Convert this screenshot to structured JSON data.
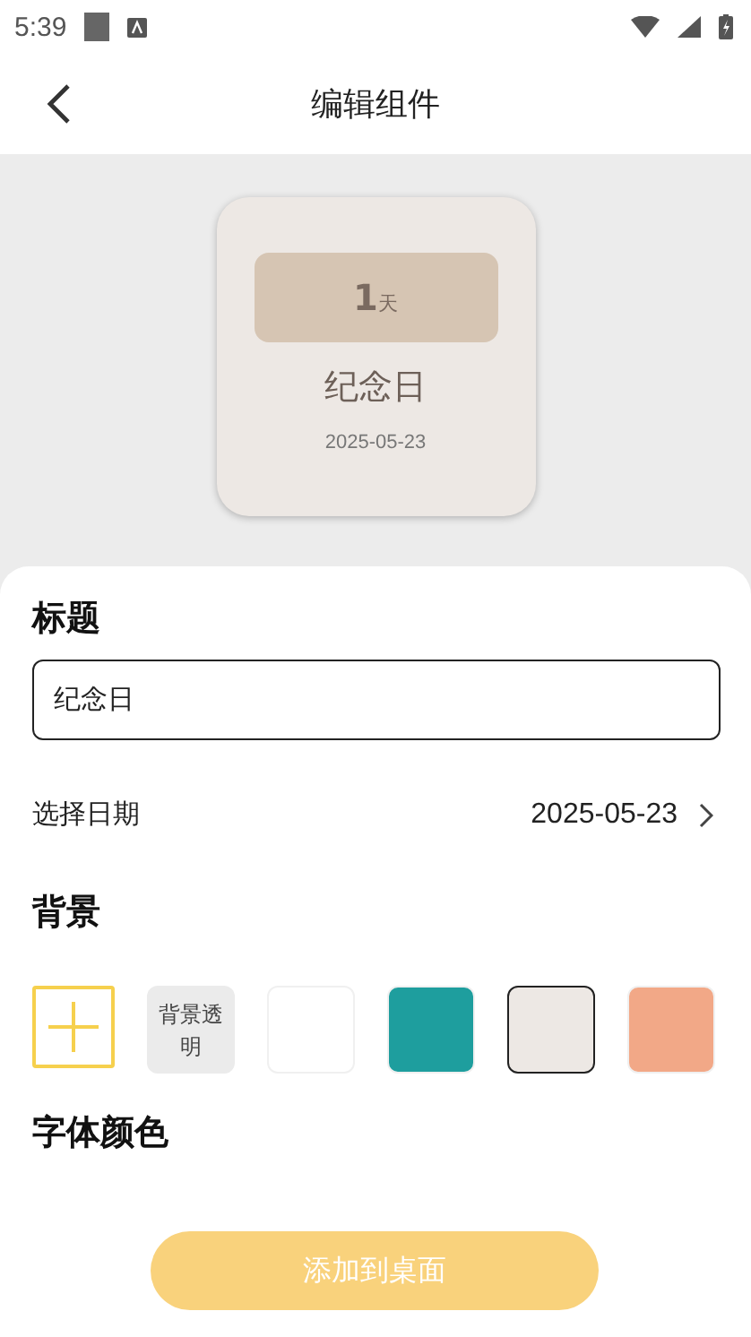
{
  "status_bar": {
    "time": "5:39"
  },
  "header": {
    "title": "编辑组件"
  },
  "preview": {
    "count": "1",
    "unit": "天",
    "name": "纪念日",
    "date": "2025-05-23"
  },
  "form": {
    "title_label": "标题",
    "title_value": "纪念日",
    "date_label": "选择日期",
    "date_value": "2025-05-23",
    "background_label": "背景",
    "swatches": [
      {
        "kind": "add",
        "selected": false
      },
      {
        "kind": "transparent",
        "label": "背景透明",
        "selected": false
      },
      {
        "kind": "color",
        "color": "#ffffff",
        "selected": false
      },
      {
        "kind": "color",
        "color": "#1e9e9e",
        "selected": false
      },
      {
        "kind": "color",
        "color": "#ede8e4",
        "selected": true
      },
      {
        "kind": "color",
        "color": "#f2a887",
        "selected": false
      }
    ],
    "font_color_label": "字体颜色"
  },
  "add_button": "添加到桌面"
}
